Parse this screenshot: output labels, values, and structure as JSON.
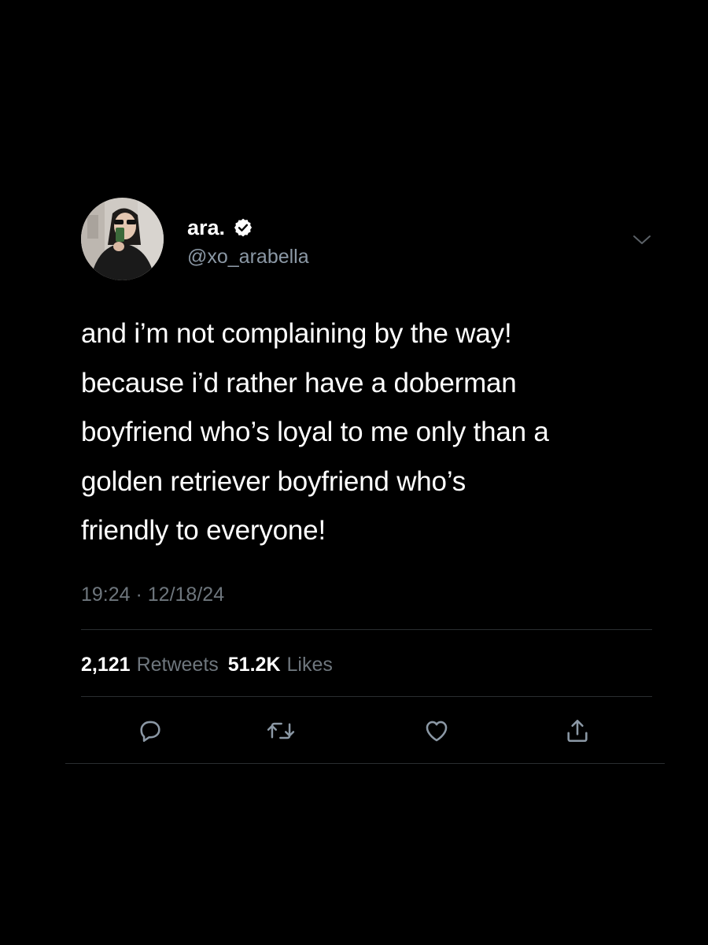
{
  "tweet": {
    "author": {
      "display_name": "ara.",
      "handle": "@xo_arabella",
      "verified": true
    },
    "text": "and i’m not complaining by the way!\nbecause i’d rather have a doberman\nboyfriend who’s loyal to me only than a\ngolden retriever boyfriend who’s\nfriendly to everyone!",
    "timestamp": "19:24 · 12/18/24",
    "stats": {
      "retweets_count": "2,121",
      "retweets_label": "Retweets",
      "likes_count": "51.2K",
      "likes_label": "Likes"
    },
    "actions": [
      "reply-icon",
      "retweet-icon",
      "like-icon",
      "share-icon"
    ]
  },
  "colors": {
    "background": "#000000",
    "primary_text": "#ffffff",
    "secondary_text": "#6e767d",
    "divider": "#2a2d30"
  }
}
